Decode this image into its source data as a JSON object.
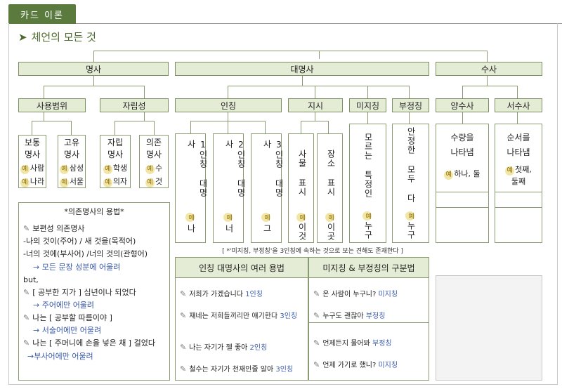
{
  "tab": "카드 이론",
  "title": "체언의 모든 것",
  "top": {
    "noun": "명사",
    "pronoun": "대명사",
    "numeral": "수사"
  },
  "noun_sub": {
    "range": "사용범위",
    "indep": "자립성"
  },
  "pron_sub": {
    "person": "인칭",
    "demo": "지시",
    "indef": "미지칭",
    "neg": "부정칭"
  },
  "num_sub": {
    "card": "양수사",
    "ord": "서수사"
  },
  "noun_cells": [
    {
      "l1": "보통",
      "l2": "명사",
      "e1": "사람",
      "e2": "나라"
    },
    {
      "l1": "고유",
      "l2": "명사",
      "e1": "삼성",
      "e2": "서울"
    },
    {
      "l1": "자립",
      "l2": "명사",
      "e1": "학생",
      "e2": "의자"
    },
    {
      "l1": "의존",
      "l2": "명사",
      "e1": "수",
      "e2": "것"
    }
  ],
  "ex_mark": "예",
  "pron_cells": [
    {
      "label": "1인칭 대명사",
      "ex": "나"
    },
    {
      "label": "2인칭 대명사",
      "ex": "너"
    },
    {
      "label": "3인칭 대명사",
      "ex": "그"
    },
    {
      "label": "사물 표시",
      "ex": "이것"
    },
    {
      "label": "장소 표시",
      "ex": "이곳"
    },
    {
      "label": "모르는 특정인",
      "ex": "누구"
    },
    {
      "label": "안정한 모두 다",
      "ex": "누구"
    }
  ],
  "num_cells": [
    {
      "l1": "수량을",
      "l2": "나타냄",
      "ex": "하나, 둘"
    },
    {
      "l1": "순서를",
      "l2": "나타냄",
      "ex": "첫째,",
      "ex2": "둘째"
    }
  ],
  "dep_box": {
    "title": "*의존명사의 용법*",
    "h1": "보편성 의존명사",
    "l1": "-나의 것이(주어) / 새 것을(목적어)",
    "l2": "-너의 것에(부사어) /너의 것의(관형어)",
    "a1": "→ 모든 문장 성분에 어울려",
    "but": "but,",
    "b1": "[ 공부한 지가 ] 십년이나 되었다",
    "a2": "→ 주어에만 어울려",
    "b2": "나는 [ 공부할 따름이야 ]",
    "a3": "→ 서술어에만 어울려",
    "b3": "나는 [ 주머니에 손을 넣은 채 ] 걸었다",
    "a4": "→부사어에만 어울려"
  },
  "note": "[ *'미지칭, 부정칭'을 3인칭에 속하는 것으로 보는 견해도 존재한다 ]",
  "usage_title": "인칭 대명사의 여러 용법",
  "usage": [
    {
      "text": "저희가 가겠습니다",
      "tag": "1인칭"
    },
    {
      "text": "쟤네는 저희들끼리만 얘기한다",
      "tag": "3인칭"
    },
    {
      "text": "나는 자기가 젤 좋아",
      "tag": "2인칭"
    },
    {
      "text": "철수는 자기가 천재인줄 알아",
      "tag": "3인칭"
    }
  ],
  "diff_title": "미지칭 & 부정칭의 구분법",
  "diff": [
    {
      "text": "온 사람이 누구니?",
      "tag": "미지칭"
    },
    {
      "text": "누구도 괜찮아",
      "tag": "부정칭"
    },
    {
      "text": "언제든지 물어봐",
      "tag": "부정칭"
    },
    {
      "text": "언제 가기로 했니?",
      "tag": "미지칭"
    }
  ],
  "colors": {
    "accent": "#5b7a3d",
    "header_bg": "#e5ecd5",
    "highlight": "#f5e9a0",
    "link": "#3a5aa8"
  }
}
